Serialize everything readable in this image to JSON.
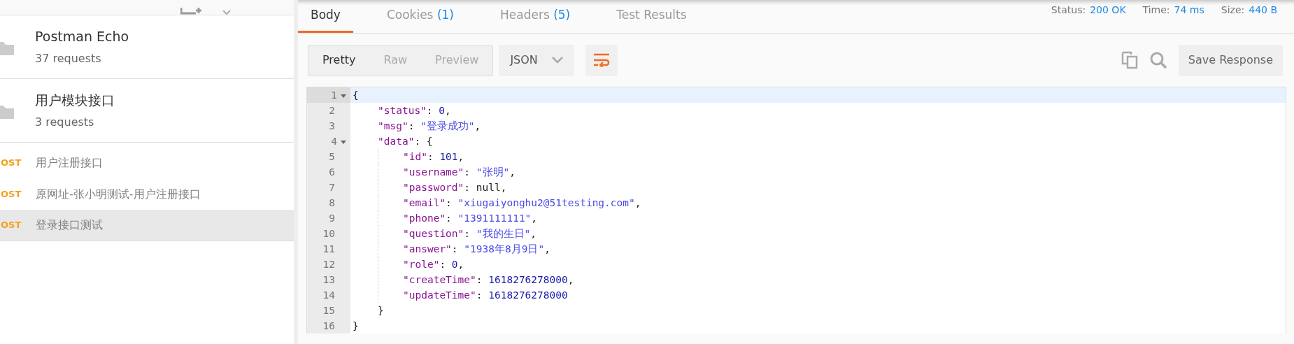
{
  "sidebar": {
    "collections": [
      {
        "name": "Postman Echo",
        "count": "37 requests"
      },
      {
        "name": "用户模块接口",
        "count": "3 requests"
      }
    ],
    "requests": [
      {
        "method": "OST",
        "name": "用户注册接口",
        "selected": false
      },
      {
        "method": "OST",
        "name": "原网址-张小明测试-用户注册接口",
        "selected": false
      },
      {
        "method": "OST",
        "name": "登录接口测试",
        "selected": true
      }
    ]
  },
  "response": {
    "tabs": [
      {
        "label": "Body",
        "selected": true
      },
      {
        "label": "Cookies",
        "count": "(1)",
        "selected": false
      },
      {
        "label": "Headers",
        "count": "(5)",
        "selected": false
      },
      {
        "label": "Test Results",
        "selected": false
      }
    ],
    "stats": [
      {
        "label": "Status:",
        "value": "200 OK"
      },
      {
        "label": "Time:",
        "value": "74 ms"
      },
      {
        "label": "Size:",
        "value": "440 B"
      }
    ],
    "view_modes": [
      {
        "label": "Pretty",
        "selected": true
      },
      {
        "label": "Raw",
        "selected": false
      },
      {
        "label": "Preview",
        "selected": false
      }
    ],
    "format": "JSON",
    "wrap": true,
    "save_button": "Save Response",
    "code": [
      {
        "number": "1",
        "foldable": true,
        "tokens": [
          {
            "kind": "punct",
            "text": "{"
          }
        ],
        "children": [
          {
            "number": "2",
            "tokens": [
              {
                "kind": "key",
                "text": "\"status\""
              },
              {
                "kind": "punct",
                "text": ": "
              },
              {
                "kind": "number",
                "text": "0"
              },
              {
                "kind": "punct",
                "text": ","
              }
            ]
          },
          {
            "number": "3",
            "tokens": [
              {
                "kind": "key",
                "text": "\"msg\""
              },
              {
                "kind": "punct",
                "text": ": "
              },
              {
                "kind": "string",
                "text": "\"登录成功\""
              },
              {
                "kind": "punct",
                "text": ","
              }
            ]
          },
          {
            "number": "4",
            "foldable": true,
            "tokens": [
              {
                "kind": "key",
                "text": "\"data\""
              },
              {
                "kind": "punct",
                "text": ": {"
              }
            ],
            "children": [
              {
                "number": "5",
                "tokens": [
                  {
                    "kind": "key",
                    "text": "\"id\""
                  },
                  {
                    "kind": "punct",
                    "text": ": "
                  },
                  {
                    "kind": "number",
                    "text": "101"
                  },
                  {
                    "kind": "punct",
                    "text": ","
                  }
                ]
              },
              {
                "number": "6",
                "tokens": [
                  {
                    "kind": "key",
                    "text": "\"username\""
                  },
                  {
                    "kind": "punct",
                    "text": ": "
                  },
                  {
                    "kind": "string",
                    "text": "\"张明\""
                  },
                  {
                    "kind": "punct",
                    "text": ","
                  }
                ]
              },
              {
                "number": "7",
                "tokens": [
                  {
                    "kind": "key",
                    "text": "\"password\""
                  },
                  {
                    "kind": "punct",
                    "text": ": null,"
                  }
                ]
              },
              {
                "number": "8",
                "tokens": [
                  {
                    "kind": "key",
                    "text": "\"email\""
                  },
                  {
                    "kind": "punct",
                    "text": ": "
                  },
                  {
                    "kind": "string",
                    "text": "\"xiugaiyonghu2@51testing.com\""
                  },
                  {
                    "kind": "punct",
                    "text": ","
                  }
                ]
              },
              {
                "number": "9",
                "tokens": [
                  {
                    "kind": "key",
                    "text": "\"phone\""
                  },
                  {
                    "kind": "punct",
                    "text": ": "
                  },
                  {
                    "kind": "string",
                    "text": "\"1391111111\""
                  },
                  {
                    "kind": "punct",
                    "text": ","
                  }
                ]
              },
              {
                "number": "10",
                "tokens": [
                  {
                    "kind": "key",
                    "text": "\"question\""
                  },
                  {
                    "kind": "punct",
                    "text": ": "
                  },
                  {
                    "kind": "string",
                    "text": "\"我的生日\""
                  },
                  {
                    "kind": "punct",
                    "text": ","
                  }
                ]
              },
              {
                "number": "11",
                "tokens": [
                  {
                    "kind": "key",
                    "text": "\"answer\""
                  },
                  {
                    "kind": "punct",
                    "text": ": "
                  },
                  {
                    "kind": "string",
                    "text": "\"1938年8月9日\""
                  },
                  {
                    "kind": "punct",
                    "text": ","
                  }
                ]
              },
              {
                "number": "12",
                "tokens": [
                  {
                    "kind": "key",
                    "text": "\"role\""
                  },
                  {
                    "kind": "punct",
                    "text": ": "
                  },
                  {
                    "kind": "number",
                    "text": "0"
                  },
                  {
                    "kind": "punct",
                    "text": ","
                  }
                ]
              },
              {
                "number": "13",
                "tokens": [
                  {
                    "kind": "key",
                    "text": "\"createTime\""
                  },
                  {
                    "kind": "punct",
                    "text": ": "
                  },
                  {
                    "kind": "number",
                    "text": "1618276278000"
                  },
                  {
                    "kind": "punct",
                    "text": ","
                  }
                ]
              },
              {
                "number": "14",
                "tokens": [
                  {
                    "kind": "key",
                    "text": "\"updateTime\""
                  },
                  {
                    "kind": "punct",
                    "text": ": "
                  },
                  {
                    "kind": "number",
                    "text": "1618276278000"
                  }
                ]
              }
            ]
          },
          {
            "number": "15",
            "tokens": [
              {
                "kind": "punct",
                "text": "}"
              }
            ]
          }
        ]
      },
      {
        "number": "16",
        "tokens": [
          {
            "kind": "punct",
            "text": "}"
          }
        ]
      }
    ]
  }
}
